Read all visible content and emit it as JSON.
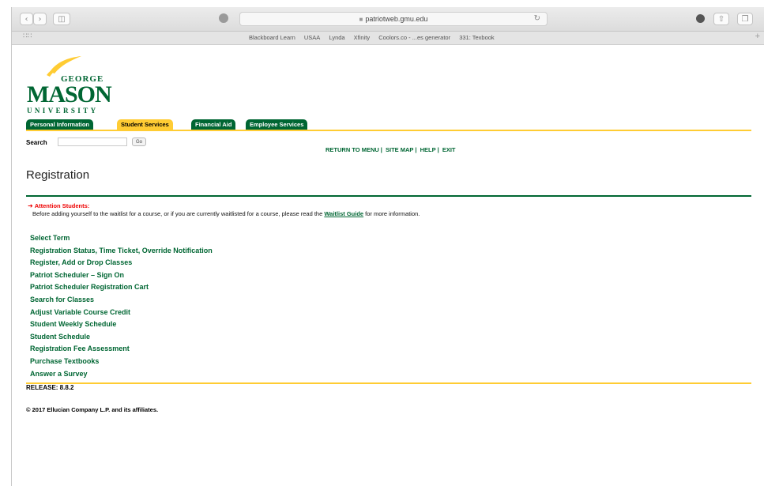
{
  "browser": {
    "url": "patriotweb.gmu.edu",
    "favorites": [
      "Blackboard Learn",
      "USAA",
      "Lynda",
      "Xfinity",
      "Coolors.co - ...es generator",
      "331: Texbook"
    ]
  },
  "logo": {
    "line1": "GEORGE",
    "line2": "MASON",
    "line3": "UNIVERSITY"
  },
  "tabs": [
    "Personal Information",
    "Student Services",
    "Financial Aid",
    "Employee Services"
  ],
  "search": {
    "label": "Search",
    "value": "",
    "go_label": "Go"
  },
  "top_menu": [
    "RETURN TO MENU",
    "SITE MAP",
    "HELP",
    "EXIT"
  ],
  "page_title": "Registration",
  "attention": {
    "heading": "Attention Students:",
    "text_before": "Before adding yourself to the waitlist for a course, or if you are currently waitlisted for a course, please read the ",
    "link": "Waitlist Guide",
    "text_after": " for more information."
  },
  "links": [
    "Select Term",
    "Registration Status, Time Ticket, Override Notification",
    "Register, Add or Drop Classes",
    "Patriot Scheduler – Sign On",
    "Patriot Scheduler Registration Cart",
    "Search for Classes",
    "Adjust Variable Course Credit",
    "Student Weekly Schedule",
    "Student Schedule",
    "Registration Fee Assessment",
    "Purchase Textbooks",
    "Answer a Survey"
  ],
  "release": "RELEASE: 8.8.2",
  "copyright": "© 2017 Ellucian Company L.P. and its affiliates.",
  "colors": {
    "mason_green": "#006633",
    "mason_gold": "#FFCC33",
    "attention_red": "#e00000"
  }
}
